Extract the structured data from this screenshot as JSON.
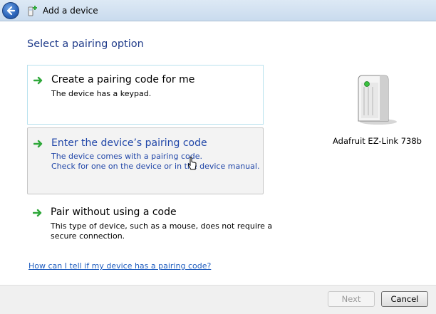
{
  "window": {
    "title": "Add a device",
    "back_icon": "back-arrow-icon",
    "title_icon": "add-device-icon"
  },
  "page": {
    "heading": "Select a pairing option"
  },
  "options": [
    {
      "title": "Create a pairing code for me",
      "description": [
        "The device has a keypad."
      ],
      "icon": "green-arrow-icon",
      "state": "normal"
    },
    {
      "title": "Enter the device’s pairing code",
      "description": [
        "The device comes with a pairing code.",
        "Check for one on the device or in the device manual."
      ],
      "icon": "green-arrow-icon",
      "state": "hover"
    },
    {
      "title": "Pair without using a code",
      "description": [
        "This type of device, such as a mouse, does not require a",
        "secure connection."
      ],
      "icon": "green-arrow-icon",
      "state": "normal"
    }
  ],
  "device": {
    "name": "Adafruit EZ-Link 738b",
    "icon": "bluetooth-device-icon"
  },
  "help_link": "How can I tell if my device has a pairing code?",
  "buttons": {
    "next": "Next",
    "next_enabled": false,
    "cancel": "Cancel"
  },
  "colors": {
    "link": "#1f5dbf",
    "heading": "#1f3b8a",
    "hover_text": "#2046a8",
    "arrow": "#2fa83a"
  }
}
